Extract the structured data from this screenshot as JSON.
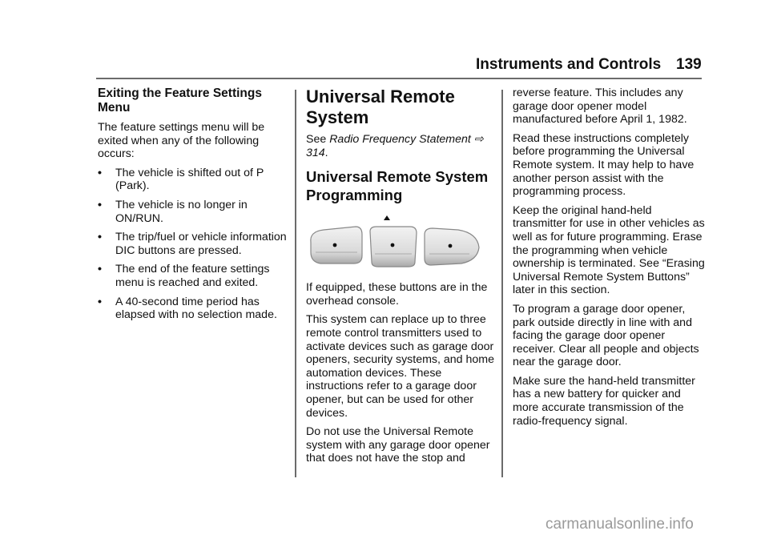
{
  "header": {
    "section_title": "Instruments and Controls",
    "page_number": "139"
  },
  "column1": {
    "heading": "Exiting the Feature Settings Menu",
    "intro": "The feature settings menu will be exited when any of the following occurs:",
    "bullet_glyph": "•",
    "bullets": [
      "The vehicle is shifted out of P (Park).",
      "The vehicle is no longer in ON/RUN.",
      "The trip/fuel or vehicle information DIC buttons are pressed.",
      "The end of the feature settings menu is reached and exited.",
      "A 40-second time period has elapsed with no selection made."
    ]
  },
  "column2": {
    "title": "Universal Remote System",
    "see_prefix": "See ",
    "see_link": "Radio Frequency Statement",
    "see_arrow": " ⇨ ",
    "see_page": "314",
    "see_suffix": ".",
    "subheading": "Universal Remote System Programming",
    "figure": {
      "description": "Three overhead console Universal Remote buttons with indicator light",
      "button_count": 3
    },
    "paragraphs": [
      "If equipped, these buttons are in the overhead console.",
      "This system can replace up to three remote control transmitters used to activate devices such as garage door openers, security systems, and home automation devices. These instructions refer to a garage door opener, but can be used for other devices.",
      "Do not use the Universal Remote system with any garage door opener that does not have the stop and"
    ]
  },
  "column3": {
    "paragraphs": [
      "reverse feature. This includes any garage door opener model manufactured before April 1, 1982.",
      "Read these instructions completely before programming the Universal Remote system. It may help to have another person assist with the programming process.",
      "Keep the original hand-held transmitter for use in other vehicles as well as for future programming. Erase the programming when vehicle ownership is terminated. See “Erasing Universal Remote System Buttons” later in this section.",
      "To program a garage door opener, park outside directly in line with and facing the garage door opener receiver. Clear all people and objects near the garage door.",
      "Make sure the hand-held transmitter has a new battery for quicker and more accurate transmission of the radio-frequency signal."
    ]
  },
  "watermark": "carmanualsonline.info"
}
